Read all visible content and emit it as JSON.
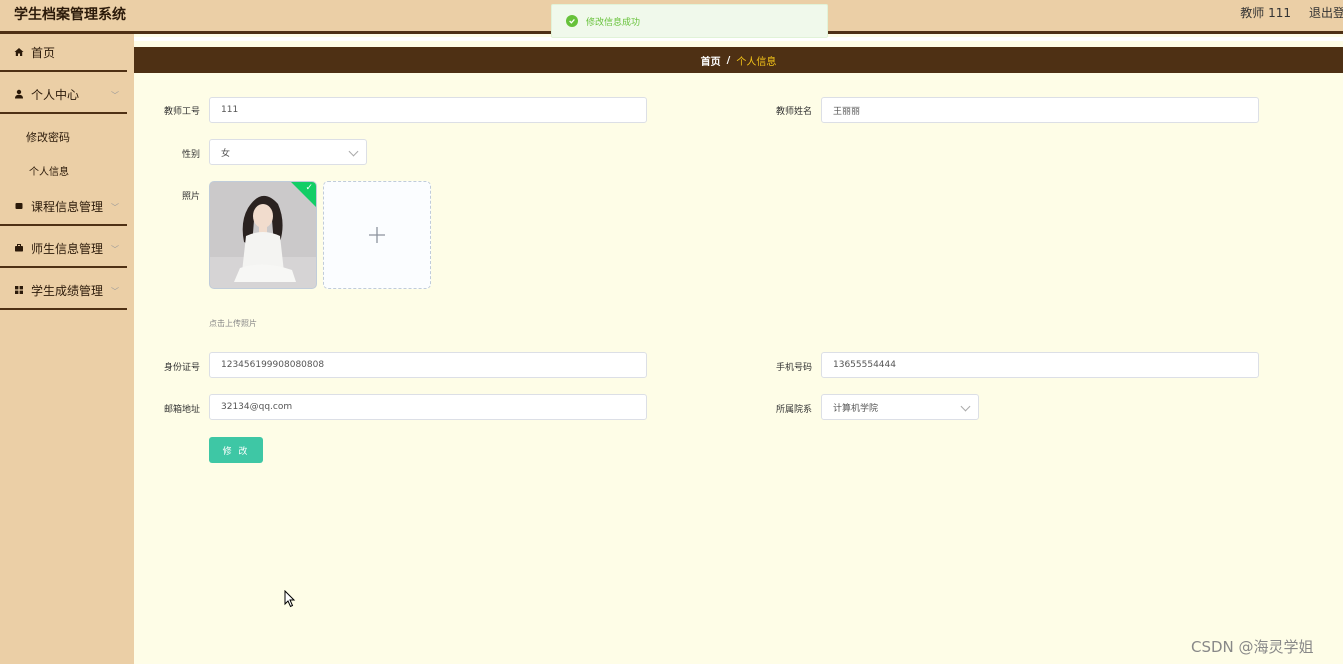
{
  "header": {
    "title": "学生档案管理系统",
    "user": "教师 111",
    "logout": "退出登"
  },
  "toast": {
    "message": "修改信息成功"
  },
  "sidebar": {
    "home": "首页",
    "personal_center": "个人中心",
    "change_password": "修改密码",
    "personal_info": "个人信息",
    "course_mgmt": "课程信息管理",
    "teacher_student_mgmt": "师生信息管理",
    "grades_mgmt": "学生成绩管理"
  },
  "breadcrumb": {
    "home": "首页",
    "sep": "/",
    "current": "个人信息"
  },
  "form": {
    "teacher_id_label": "教师工号",
    "teacher_id_value": "111",
    "teacher_name_label": "教师姓名",
    "teacher_name_value": "王丽丽",
    "gender_label": "性别",
    "gender_value": "女",
    "photo_label": "照片",
    "upload_hint": "点击上传照片",
    "id_card_label": "身份证号",
    "id_card_value": "123456199908080808",
    "phone_label": "手机号码",
    "phone_value": "13655554444",
    "email_label": "邮箱地址",
    "email_value": "32134@qq.com",
    "department_label": "所属院系",
    "department_value": "计算机学院",
    "submit": "修 改"
  },
  "watermark": "CSDN @海灵学姐",
  "colors": {
    "header_bg": "#ebcfa6",
    "dark_brown": "#4e3014",
    "main_bg": "#fefde7",
    "accent": "#3ec7a5",
    "success": "#67c23a",
    "breadcrumb_current": "#f5c518"
  }
}
